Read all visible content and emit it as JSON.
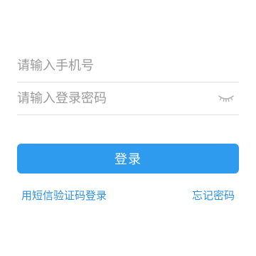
{
  "form": {
    "phone": {
      "value": "",
      "placeholder": "请输入手机号"
    },
    "password": {
      "value": "",
      "placeholder": "请输入登录密码",
      "toggle_icon": "eye-closed-icon"
    },
    "login_button_label": "登录"
  },
  "links": {
    "sms_login": "用短信验证码登录",
    "forgot_password": "忘记密码"
  },
  "colors": {
    "primary": "#2e9bef",
    "link": "#2e8fdc",
    "placeholder": "#9a9a9a",
    "divider": "#e4e4e4"
  }
}
